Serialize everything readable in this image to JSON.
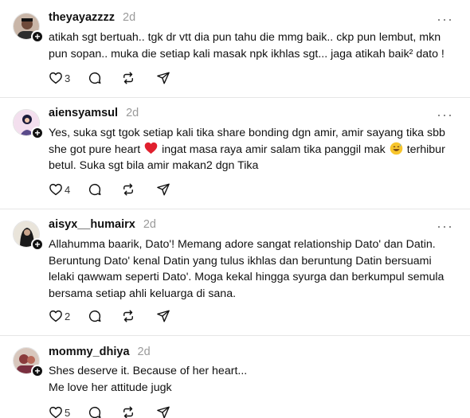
{
  "posts": [
    {
      "username": "theyayazzzz",
      "time": "2d",
      "lines": [
        "atikah sgt bertuah.. tgk dr vtt dia pun tahu die mmg baik.. ckp pun lembut, mkn",
        "pun sopan.. muka die setiap kali masak npk ikhlas sgt... jaga atikah baik² dato !"
      ],
      "likes": "3"
    },
    {
      "username": "aiensyamsul",
      "time": "2d",
      "lines": [
        "Yes, suka sgt tgok setiap kali tika share bonding dgn amir, amir sayang tika sbb",
        "she got pure heart",
        "ingat masa raya amir salam tika panggil mak",
        "terhibur",
        "betul. Suka sgt bila amir makan2 dgn Tika"
      ],
      "likes": "4"
    },
    {
      "username": "aisyx__humairx",
      "time": "2d",
      "lines": [
        "Allahumma baarik, Dato'! Memang adore sangat relationship Dato' dan Datin.",
        "Beruntung Dato' kenal Datin yang tulus ikhlas dan beruntung Datin bersuami",
        "lelaki qawwam seperti Dato'. Moga kekal hingga syurga dan berkumpul semula",
        "bersama setiap ahli keluarga di sana."
      ],
      "likes": "2"
    },
    {
      "username": "mommy_dhiya",
      "time": "2d",
      "lines": [
        "Shes deserve it. Because of her heart...",
        "Me love her attitude jugk"
      ],
      "likes": "5"
    }
  ],
  "ui": {
    "more_label": "···",
    "follow_glyph": "+"
  },
  "icons": [
    "heart-icon",
    "comment-icon",
    "repost-icon",
    "share-icon",
    "more-icon",
    "follow-plus-icon"
  ],
  "colors": {
    "text": "#111111",
    "muted": "#9a9a9a",
    "divider": "#e6e6e6",
    "heart_emoji": "#e0202e"
  }
}
